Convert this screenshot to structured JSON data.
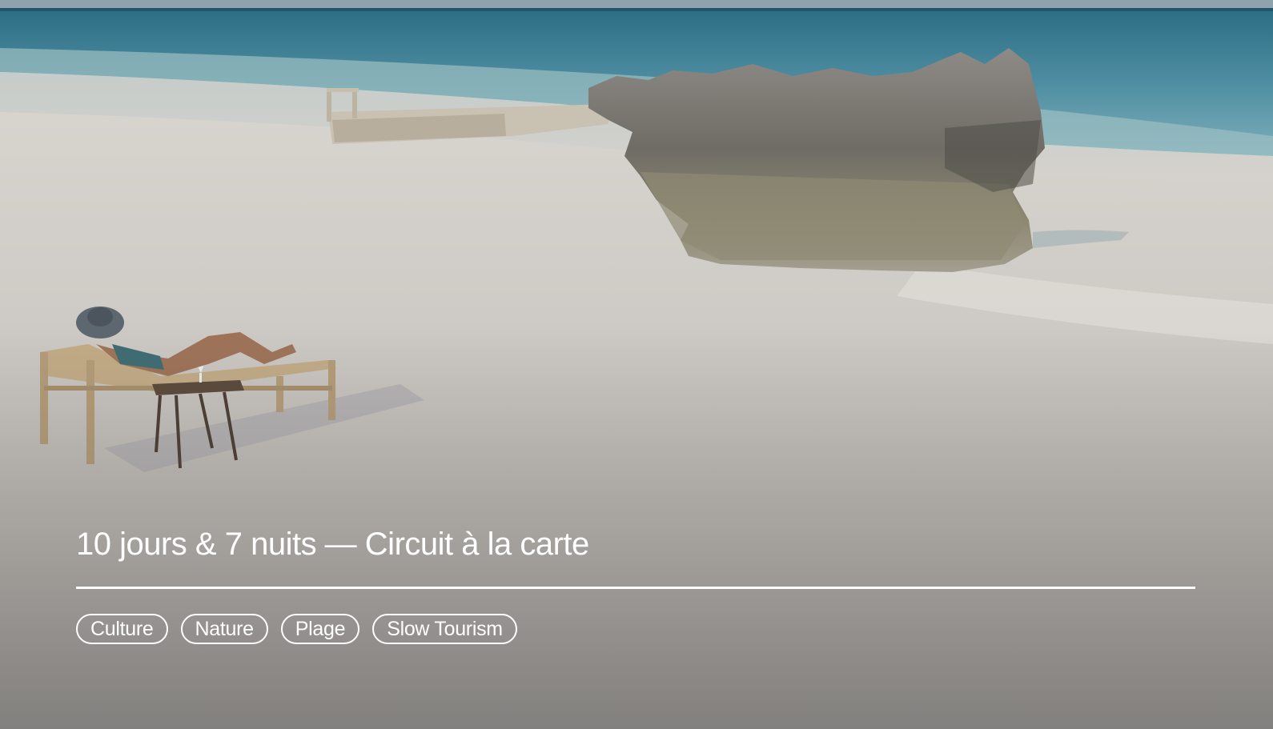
{
  "card": {
    "title": "10 jours & 7 nuits — Circuit à la carte",
    "tags": [
      {
        "label": "Culture"
      },
      {
        "label": "Nature"
      },
      {
        "label": "Plage"
      },
      {
        "label": "Slow Tourism"
      }
    ]
  },
  "colors": {
    "text": "#ffffff",
    "sand": "#c9c5c0",
    "sea": "#4a8aa0"
  }
}
